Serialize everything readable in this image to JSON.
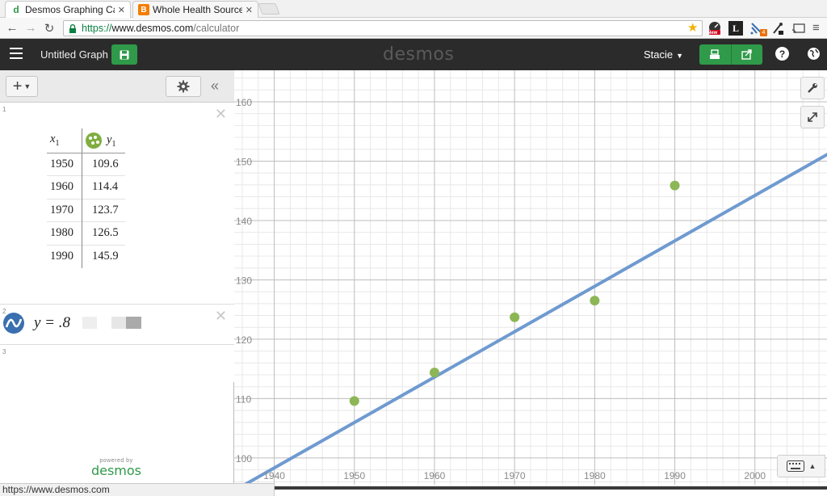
{
  "browser": {
    "tabs": [
      {
        "title": "Desmos Graphing Ca",
        "favicon": "desmos-d-icon",
        "active": true
      },
      {
        "title": "Whole Health Source",
        "favicon": "blogger-icon",
        "active": false
      }
    ],
    "url": {
      "protocol": "https://",
      "host": "www.desmos.com",
      "path": "/calculator"
    },
    "extensions": [
      "speedometer-icon",
      "l-icon",
      "notification-icon",
      "eyedropper-icon",
      "cast-icon",
      "chrome-menu-icon"
    ],
    "ext_badges": {
      "new": "New",
      "count": "4"
    },
    "status_url": "https://www.desmos.com"
  },
  "header": {
    "graph_title": "Untitled Graph",
    "logo": "desmos",
    "user": "Stacie",
    "help_label": "?"
  },
  "panel": {
    "expressions": [
      {
        "index": "1",
        "type": "table"
      },
      {
        "index": "2",
        "type": "expression",
        "formula_visible": "y = .8"
      },
      {
        "index": "3",
        "type": "empty"
      }
    ],
    "table": {
      "col1_var": "x",
      "col1_sub": "1",
      "col2_var": "y",
      "col2_sub": "1",
      "rows": [
        [
          "1950",
          "109.6"
        ],
        [
          "1960",
          "114.4"
        ],
        [
          "1970",
          "123.7"
        ],
        [
          "1980",
          "126.5"
        ],
        [
          "1990",
          "145.9"
        ]
      ]
    },
    "powered_small": "powered by",
    "powered_brand": "desmos"
  },
  "colors": {
    "points": "#8db657",
    "line": "#6f9ad0",
    "accent_green": "#2f9a49",
    "header_bg": "#2b2b2b"
  },
  "chart_data": {
    "type": "scatter",
    "title": "",
    "xlabel": "",
    "ylabel": "",
    "x_ticks": [
      "1940",
      "1950",
      "1960",
      "1970",
      "1980",
      "1990",
      "2000"
    ],
    "y_ticks": [
      "100",
      "110",
      "120",
      "130",
      "140",
      "150",
      "160"
    ],
    "xlim": [
      1935,
      2009
    ],
    "ylim": [
      95.5,
      165.3
    ],
    "grid": true,
    "series": [
      {
        "type": "scatter",
        "x": [
          1950,
          1960,
          1970,
          1980,
          1990
        ],
        "y": [
          109.6,
          114.4,
          123.7,
          126.5,
          145.9
        ]
      },
      {
        "type": "line",
        "x": [
          1935,
          2009
        ],
        "y": [
          94.5,
          151.1
        ]
      }
    ]
  }
}
